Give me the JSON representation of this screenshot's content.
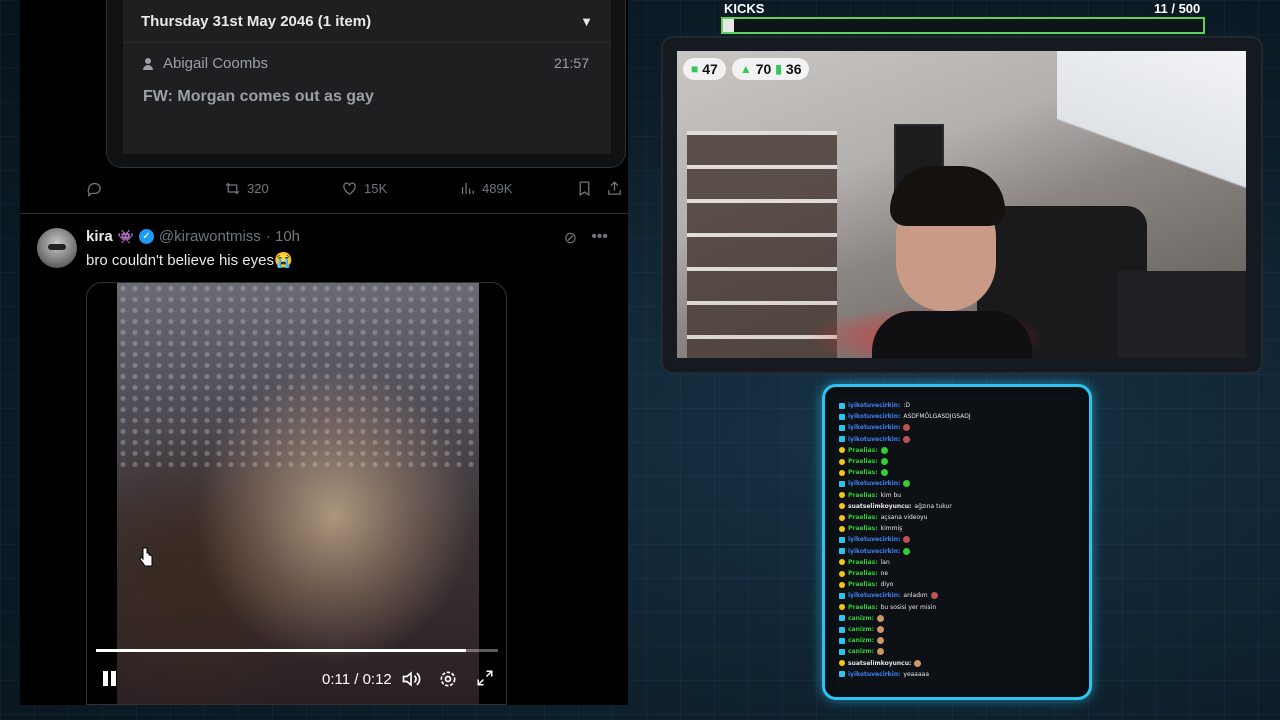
{
  "quote": {
    "date_header": "Thursday 31st May 2046 (1 item)",
    "sender": "Abigail Coombs",
    "time": "21:57",
    "subject": "FW: Morgan comes out as gay"
  },
  "actions": {
    "retweets": "320",
    "likes": "15K",
    "views": "489K"
  },
  "tweet": {
    "name": "kira",
    "emoji": "👾",
    "handle": "@kirawontmiss",
    "age": "· 10h",
    "text": "bro couldn't believe his eyes😭"
  },
  "video": {
    "time": "0:11 / 0:12",
    "progress": 0.92
  },
  "kicks": {
    "label": "KICKS",
    "count": "11  / 500",
    "progress": 0.022
  },
  "cam_stats": {
    "stat1": "47",
    "stat2": "70",
    "stat3": "36"
  },
  "colors": {
    "chat_border": "#2ec4f0",
    "kicks_border": "#5ad15a",
    "user_blue": "#3b82f6",
    "user_green": "#32cd32"
  },
  "chat": [
    {
      "user": "iyikotuvecirkin",
      "msg": ":D",
      "color": "#3b82f6",
      "badge": 1
    },
    {
      "user": "iyikotuvecirkin",
      "msg": "ASDFMÖLGASDJGSADJ",
      "color": "#3b82f6",
      "badge": 1
    },
    {
      "user": "iyikotuvecirkin",
      "msg": "",
      "color": "#3b82f6",
      "badge": 1,
      "emote": "#b55"
    },
    {
      "user": "iyikotuvecirkin",
      "msg": "",
      "color": "#3b82f6",
      "badge": 1,
      "emote": "#b55"
    },
    {
      "user": "Praelias",
      "msg": "",
      "color": "#32cd32",
      "badge": 2,
      "emote": "#3c3"
    },
    {
      "user": "Praelias",
      "msg": "",
      "color": "#32cd32",
      "badge": 2,
      "emote": "#3c3"
    },
    {
      "user": "Praelias",
      "msg": "",
      "color": "#32cd32",
      "badge": 2,
      "emote": "#3c3"
    },
    {
      "user": "iyikotuvecirkin",
      "msg": "",
      "color": "#3b82f6",
      "badge": 1,
      "emote": "#3c3"
    },
    {
      "user": "Praelias",
      "msg": "kim bu",
      "color": "#32cd32",
      "badge": 2
    },
    {
      "user": "suatselimkoyuncu",
      "msg": "ağzına tukur",
      "color": "#e6e6e6",
      "badge": 2
    },
    {
      "user": "Praelias",
      "msg": "açsana videoyu",
      "color": "#32cd32",
      "badge": 2
    },
    {
      "user": "Praelias",
      "msg": "kimmiş",
      "color": "#32cd32",
      "badge": 2
    },
    {
      "user": "iyikotuvecirkin",
      "msg": "",
      "color": "#3b82f6",
      "badge": 1,
      "emote": "#b55"
    },
    {
      "user": "iyikotuvecirkin",
      "msg": "",
      "color": "#3b82f6",
      "badge": 1,
      "emote": "#3c3"
    },
    {
      "user": "Praelias",
      "msg": "lan",
      "color": "#32cd32",
      "badge": 2
    },
    {
      "user": "Praelias",
      "msg": "ne",
      "color": "#32cd32",
      "badge": 2
    },
    {
      "user": "Praelias",
      "msg": "diyo",
      "color": "#32cd32",
      "badge": 2
    },
    {
      "user": "iyikotuvecirkin",
      "msg": "anladım",
      "color": "#3b82f6",
      "badge": 1,
      "emote": "#b55"
    },
    {
      "user": "Praelias",
      "msg": "bu sosisi yer misin",
      "color": "#32cd32",
      "badge": 2
    },
    {
      "user": "canizm",
      "msg": "",
      "color": "#32cd32",
      "badge": 1,
      "emote": "#c96"
    },
    {
      "user": "canizm",
      "msg": "",
      "color": "#32cd32",
      "badge": 1,
      "emote": "#c96"
    },
    {
      "user": "canizm",
      "msg": "",
      "color": "#32cd32",
      "badge": 1,
      "emote": "#c96"
    },
    {
      "user": "canizm",
      "msg": "",
      "color": "#32cd32",
      "badge": 1,
      "emote": "#c96"
    },
    {
      "user": "suatselimkoyuncu",
      "msg": "",
      "color": "#e6e6e6",
      "badge": 2,
      "emote": "#c96"
    },
    {
      "user": "iyikotuvecirkin",
      "msg": "yeaaaaa",
      "color": "#3b82f6",
      "badge": 1
    }
  ]
}
